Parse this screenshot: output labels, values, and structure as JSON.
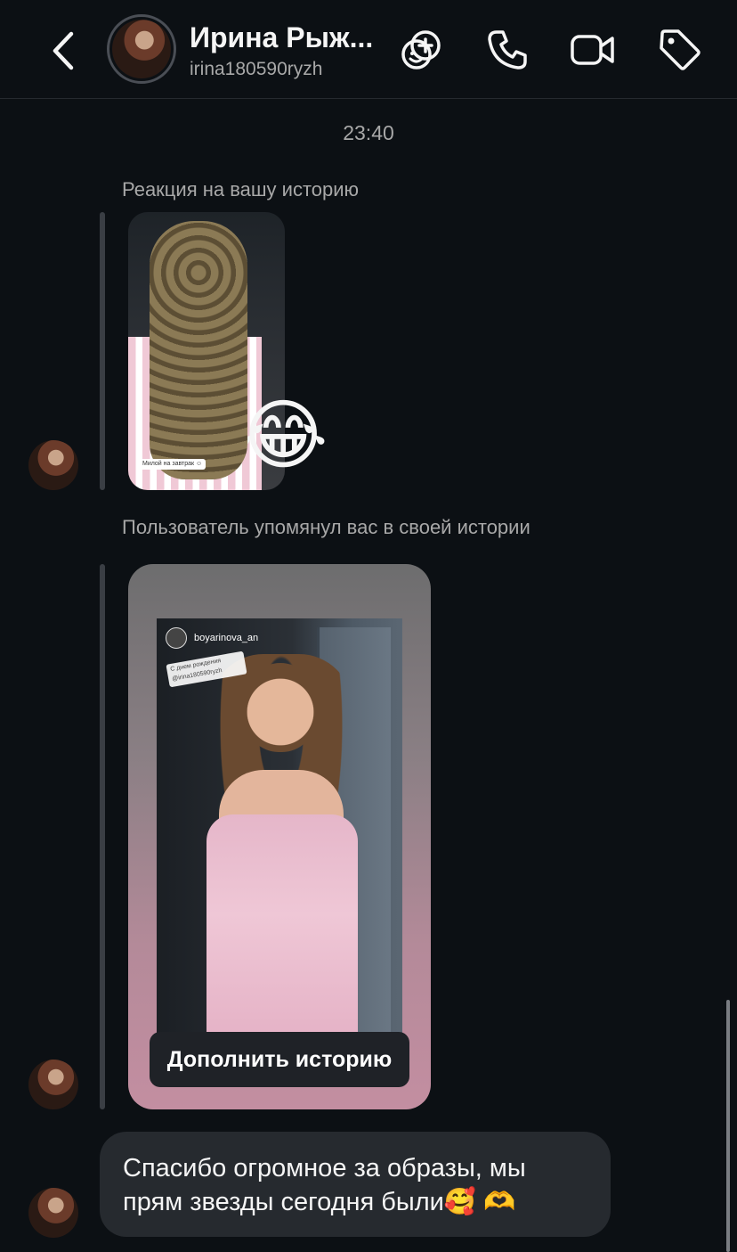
{
  "header": {
    "contact_name": "Ирина Рыж...",
    "contact_username": "irina180590ryzh",
    "icons": [
      "back-arrow-icon",
      "add-sticker-icon",
      "phone-icon",
      "video-camera-icon",
      "tag-icon"
    ]
  },
  "thread": {
    "timestamp": "23:40",
    "story_reaction": {
      "label": "Реакция на вашу историю",
      "sticker_text": "Милой на завтрак ☺",
      "reaction_emoji": "😂"
    },
    "mention": {
      "label": "Пользователь упомянул вас в своей истории",
      "story_username": "boyarinova_an",
      "sticker_text": "С днем рождения @irina180590ryzh",
      "button_label": "Дополнить историю"
    },
    "message": {
      "text": "Спасибо огромное за образы, мы прям звезды сегодня были🥰 🫶"
    }
  }
}
